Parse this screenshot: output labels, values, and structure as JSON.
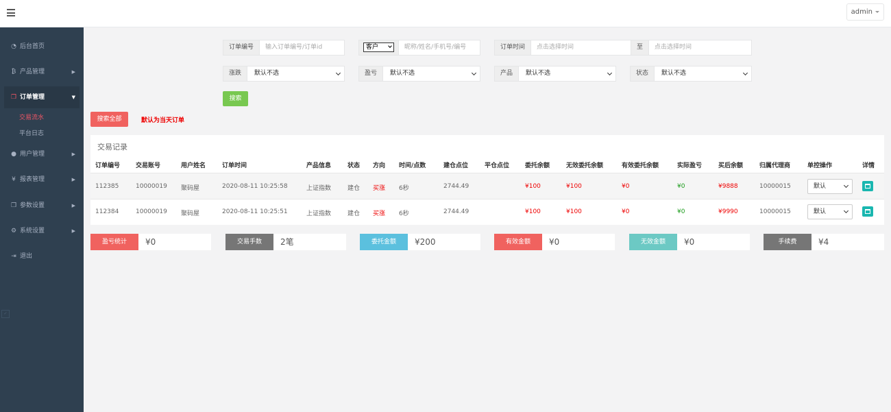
{
  "header": {
    "admin_label": "admin"
  },
  "sidebar": {
    "items": [
      {
        "icon": "dashboard-icon",
        "label": "后台首页"
      },
      {
        "icon": "bitcoin-icon",
        "label": "产品管理"
      },
      {
        "icon": "copy-icon",
        "label": "订单管理"
      },
      {
        "icon": "user-icon",
        "label": "用户管理"
      },
      {
        "icon": "yen-icon",
        "label": "报表管理"
      },
      {
        "icon": "files-icon",
        "label": "参数设置"
      },
      {
        "icon": "cogs-icon",
        "label": "系统设置"
      },
      {
        "icon": "sign-out-icon",
        "label": "退出"
      }
    ],
    "subitems": [
      "交易流水",
      "平台日志"
    ]
  },
  "filters": {
    "order_no_label": "订单编号",
    "order_no_placeholder": "输入订单编号/订单id",
    "customer_select": "客户",
    "customer_placeholder": "昵称/姓名/手机号/编号",
    "order_time_label": "订单时间",
    "time_start_placeholder": "点击选择时间",
    "to_label": "至",
    "time_end_placeholder": "点击选择时间",
    "rise_fall_label": "涨跌",
    "profit_label": "盈亏",
    "product_label": "产品",
    "status_label": "状态",
    "default_option": "默认不选",
    "search_button": "搜索",
    "search_all_button": "搜索全部",
    "default_note": "默认为当天订单"
  },
  "table": {
    "title": "交易记录",
    "headers": [
      "订单编号",
      "交易账号",
      "用户姓名",
      "订单时间",
      "产品信息",
      "状态",
      "方向",
      "时间/点数",
      "建仓点位",
      "平仓点位",
      "委托余额",
      "无效委托余额",
      "有效委托余额",
      "实际盈亏",
      "买后余额",
      "归属代理商",
      "单控操作",
      "详情"
    ],
    "rows": [
      [
        "112385",
        "10000019",
        "聚码屋",
        "2020-08-11 10:25:58",
        "上证指数",
        "建仓",
        "买涨",
        "6秒",
        "2744.49",
        "",
        "¥100",
        "¥100",
        "¥0",
        "¥0",
        "¥9888",
        "10000015",
        "默认"
      ],
      [
        "112384",
        "10000019",
        "聚码屋",
        "2020-08-11 10:25:51",
        "上证指数",
        "建仓",
        "买涨",
        "6秒",
        "2744.49",
        "",
        "¥100",
        "¥100",
        "¥0",
        "¥0",
        "¥9990",
        "10000015",
        "默认"
      ]
    ]
  },
  "stats": [
    {
      "label": "盈亏统计",
      "value": "¥0",
      "color": "#f0625f"
    },
    {
      "label": "交易手数",
      "value": "2笔",
      "color": "#767676"
    },
    {
      "label": "委托金额",
      "value": "¥200",
      "color": "#5bc0de"
    },
    {
      "label": "有效金额",
      "value": "¥0",
      "color": "#f0625f"
    },
    {
      "label": "无效金额",
      "value": "¥0",
      "color": "#6cc9c4"
    },
    {
      "label": "手续费",
      "value": "¥4",
      "color": "#767676"
    }
  ]
}
